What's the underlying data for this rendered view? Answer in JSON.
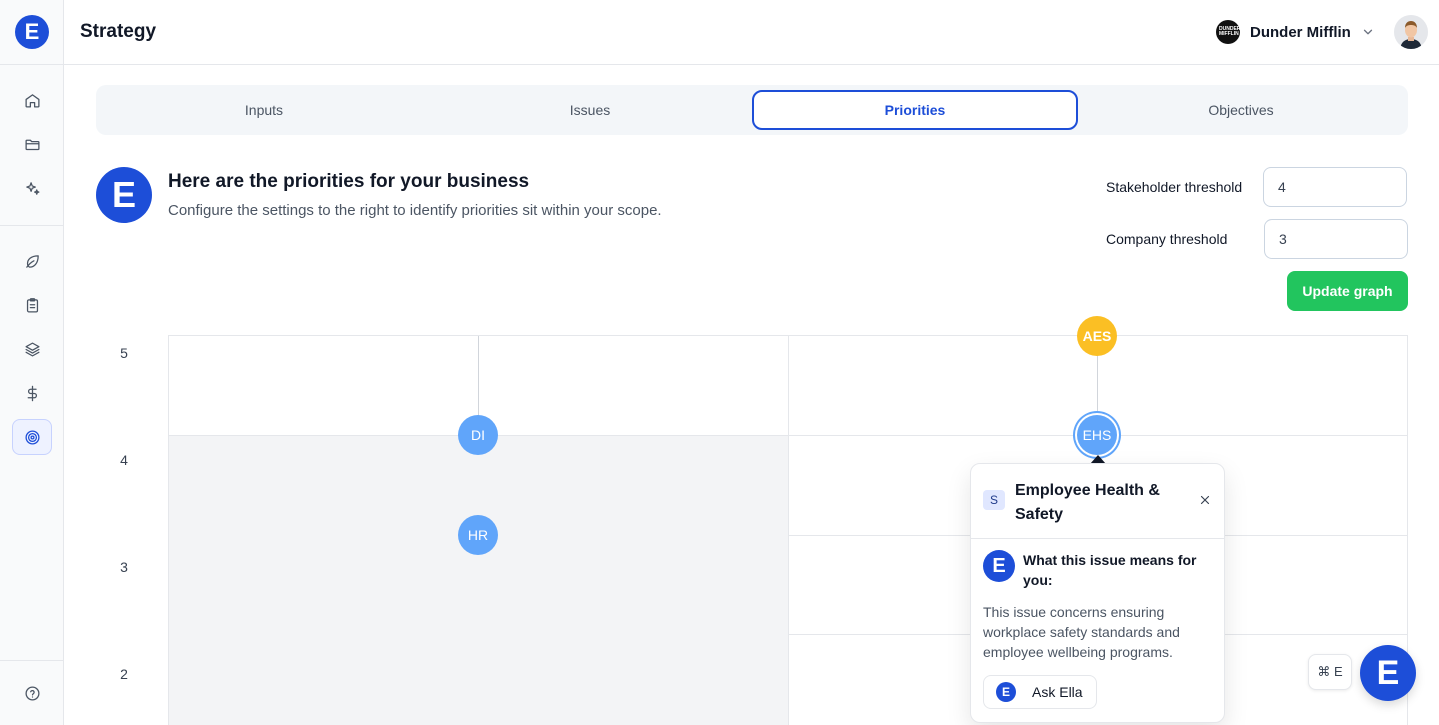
{
  "app": {
    "logo_letter": "E"
  },
  "header": {
    "title": "Strategy",
    "org_name": "Dunder Mifflin",
    "org_logo_text": "DUNDER MIFFLIN"
  },
  "sidebar": {
    "items": [
      {
        "icon": "home-icon",
        "active": false
      },
      {
        "icon": "folder-icon",
        "active": false
      },
      {
        "icon": "sparkle-icon",
        "active": false
      },
      {
        "icon": "leaf-icon",
        "active": false
      },
      {
        "icon": "clipboard-icon",
        "active": false
      },
      {
        "icon": "layers-icon",
        "active": false
      },
      {
        "icon": "dollar-icon",
        "active": false
      },
      {
        "icon": "target-icon",
        "active": true
      },
      {
        "icon": "help-icon",
        "active": false
      }
    ]
  },
  "tabs": [
    {
      "label": "Inputs",
      "active": false
    },
    {
      "label": "Issues",
      "active": false
    },
    {
      "label": "Priorities",
      "active": true
    },
    {
      "label": "Objectives",
      "active": false
    }
  ],
  "intro": {
    "logo_letter": "E",
    "title": "Here are the priorities for your business",
    "subtitle": "Configure the settings to the right to identify priorities sit within your scope."
  },
  "thresholds": {
    "stakeholder_label": "Stakeholder threshold",
    "stakeholder_value": "4",
    "company_label": "Company threshold",
    "company_value": "3",
    "update_label": "Update graph"
  },
  "graph": {
    "y_ticks": [
      "5",
      "4",
      "3",
      "2"
    ],
    "nodes": [
      {
        "label": "AES",
        "color": "#fbbf24"
      },
      {
        "label": "DI",
        "color": "#60a5fa"
      },
      {
        "label": "EHS",
        "color": "#60a5fa",
        "selected": true
      },
      {
        "label": "HR",
        "color": "#60a5fa"
      }
    ]
  },
  "popover": {
    "badge": "S",
    "title": "Employee Health & Safety",
    "ella_letter": "E",
    "question": "What this issue means for you:",
    "description": "This issue concerns ensuring workplace safety standards and employee wellbeing programs.",
    "ask_label": "Ask Ella",
    "ask_letter": "E"
  },
  "shortcut": {
    "label": "⌘ E"
  },
  "fab": {
    "letter": "E"
  },
  "colors": {
    "accent": "#1d4ed8",
    "success": "#22c55e",
    "node_blue": "#60a5fa",
    "node_amber": "#fbbf24"
  }
}
